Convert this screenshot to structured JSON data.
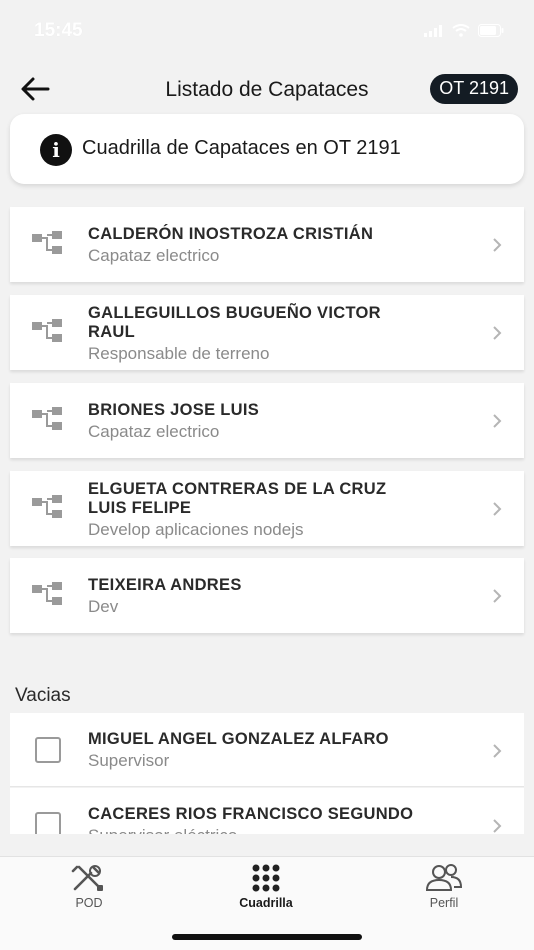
{
  "status_bar": {
    "time": "15:45"
  },
  "header": {
    "title": "Listado de Capataces",
    "ot_badge": "OT 2191"
  },
  "info": {
    "text": "Cuadrilla de Capataces  en OT 2191"
  },
  "capataces": [
    {
      "name_lines": [
        "CALDERÓN INOSTROZA CRISTIÁN"
      ],
      "role": "Capataz electrico"
    },
    {
      "name_lines": [
        "GALLEGUILLOS BUGUEÑO VICTOR",
        "RAUL"
      ],
      "role": "Responsable de terreno"
    },
    {
      "name_lines": [
        "BRIONES JOSE LUIS"
      ],
      "role": "Capataz electrico"
    },
    {
      "name_lines": [
        "ELGUETA CONTRERAS DE LA CRUZ",
        "LUIS FELIPE"
      ],
      "role": "Develop aplicaciones nodejs"
    },
    {
      "name_lines": [
        "TEIXEIRA ANDRES"
      ],
      "role": "Dev"
    }
  ],
  "vacias_section": {
    "label": "Vacias",
    "items": [
      {
        "name": "MIGUEL ANGEL GONZALEZ ALFARO",
        "role": "Supervisor"
      },
      {
        "name": "CACERES RIOS FRANCISCO SEGUNDO",
        "role": "Supervisor eléctrico"
      }
    ]
  },
  "tab_bar": {
    "tabs": [
      {
        "label": "POD",
        "icon": "tools-icon",
        "active": false
      },
      {
        "label": "Cuadrilla",
        "icon": "grid-dots-icon",
        "active": true
      },
      {
        "label": "Perfil",
        "icon": "users-icon",
        "active": false
      }
    ]
  },
  "colors": {
    "background": "#f2f2f2",
    "card": "#ffffff",
    "badge_bg": "#141c24",
    "subtitle": "#8a8a8a",
    "icon_gray": "#9a9a9a"
  }
}
